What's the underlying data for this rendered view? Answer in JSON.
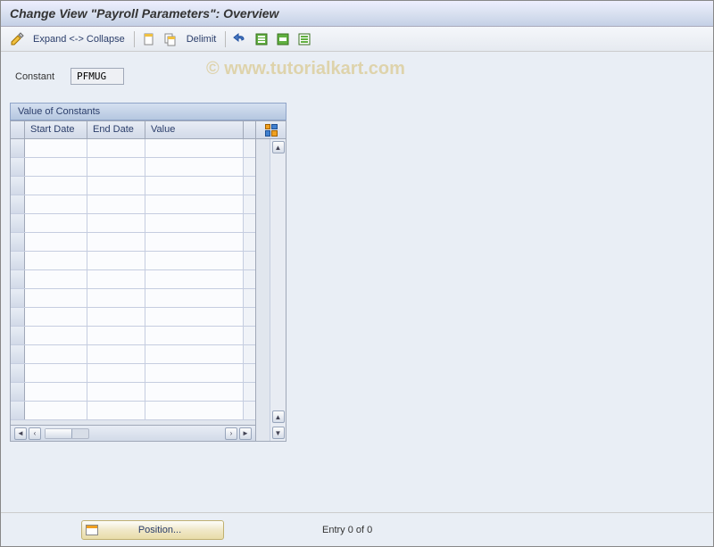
{
  "title": "Change View \"Payroll Parameters\": Overview",
  "toolbar": {
    "expand_collapse": "Expand <-> Collapse",
    "delimit": "Delimit"
  },
  "field": {
    "constant_label": "Constant",
    "constant_value": "PFMUG"
  },
  "panel": {
    "title": "Value of Constants",
    "columns": {
      "start_date": "Start Date",
      "end_date": "End Date",
      "value": "Value"
    }
  },
  "footer": {
    "position_label": "Position...",
    "entry_text": "Entry 0 of 0"
  },
  "watermark": "© www.tutorialkart.com"
}
